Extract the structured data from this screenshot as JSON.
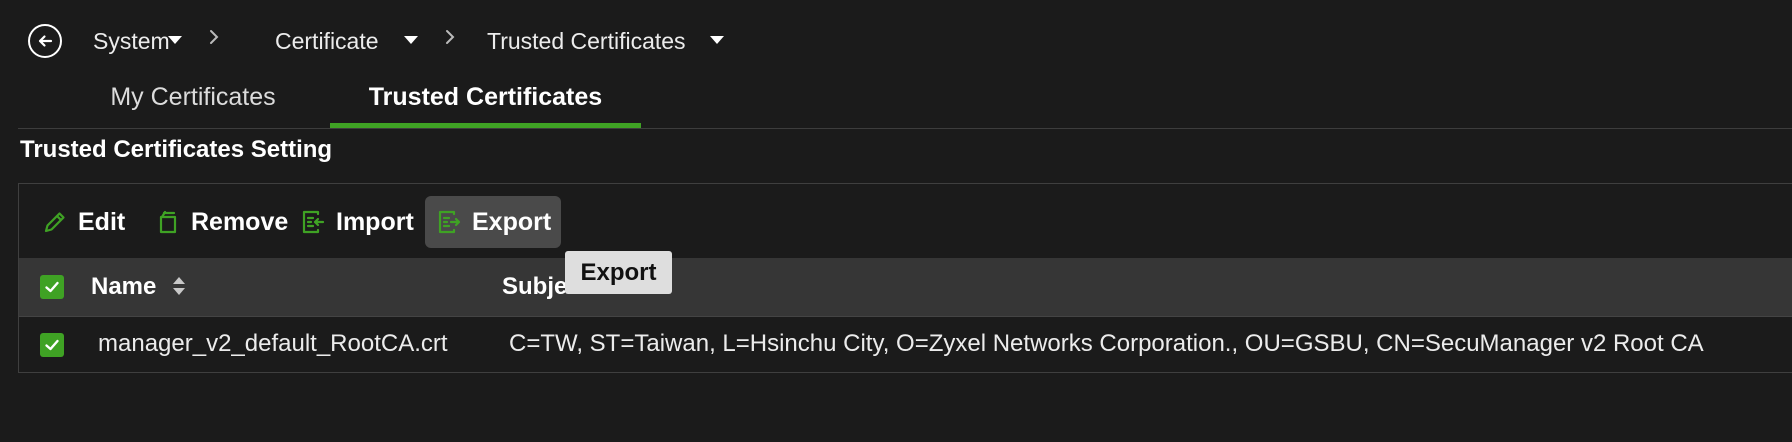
{
  "breadcrumb": {
    "items": [
      {
        "label": "System"
      },
      {
        "label": "Certificate"
      },
      {
        "label": "Trusted Certificates"
      }
    ]
  },
  "tabs": [
    {
      "label": "My Certificates",
      "active": false
    },
    {
      "label": "Trusted Certificates",
      "active": true
    }
  ],
  "section": {
    "title": "Trusted Certificates Setting"
  },
  "toolbar": {
    "edit_label": "Edit",
    "remove_label": "Remove",
    "import_label": "Import",
    "export_label": "Export"
  },
  "table": {
    "columns": [
      "Name",
      "Subject"
    ],
    "rows": [
      {
        "name": "manager_v2_default_RootCA.crt",
        "subject": "C=TW, ST=Taiwan, L=Hsinchu City, O=Zyxel Networks Corporation., OU=GSBU, CN=SecuManager v2 Root CA"
      }
    ]
  },
  "tooltip": {
    "text": "Export"
  },
  "colors": {
    "background": "#1b1b1b",
    "accent": "#3fa224",
    "header_bg": "#363636",
    "tooltip_bg": "#dedede"
  },
  "icons": {
    "back": "arrow-left-circle-icon",
    "edit": "pencil-icon",
    "remove": "trash-icon",
    "import": "import-icon",
    "export": "export-icon",
    "sort": "sort-icon",
    "dropdown": "caret-down-icon",
    "separator": "chevron-right-icon"
  }
}
